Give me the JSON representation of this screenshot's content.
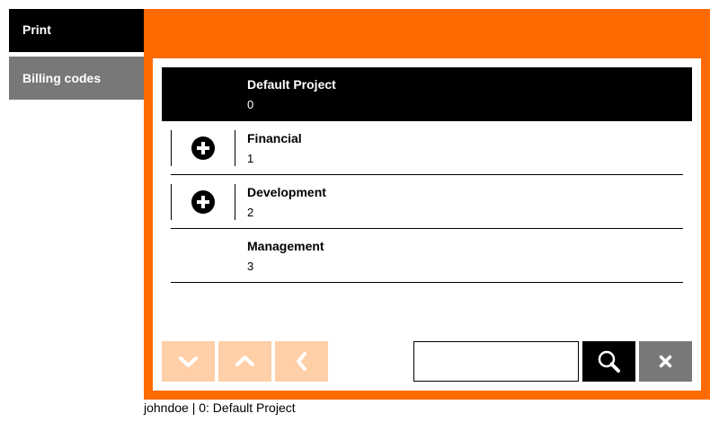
{
  "tabs": {
    "print": "Print",
    "billing_codes": "Billing codes"
  },
  "list": {
    "items": [
      {
        "name": "Default Project",
        "code": "0",
        "selected": true,
        "expandable": false
      },
      {
        "name": "Financial",
        "code": "1",
        "selected": false,
        "expandable": true
      },
      {
        "name": "Development",
        "code": "2",
        "selected": false,
        "expandable": true
      },
      {
        "name": "Management",
        "code": "3",
        "selected": false,
        "expandable": false
      }
    ]
  },
  "icons": {
    "expand": "plus-circle-icon",
    "down": "chevron-down-icon",
    "up": "chevron-up-icon",
    "back": "chevron-left-icon",
    "search": "magnifier-icon",
    "clear": "close-icon"
  },
  "search": {
    "value": "",
    "placeholder": ""
  },
  "status": {
    "text": "johndoe | 0: Default Project"
  },
  "colors": {
    "accent": "#ff6a00",
    "selected_bg": "#000000",
    "tab_active": "#000000",
    "tab_inactive": "#787878",
    "nav_button": "#ffcfa8",
    "search_button": "#000000",
    "clear_button": "#787878"
  }
}
